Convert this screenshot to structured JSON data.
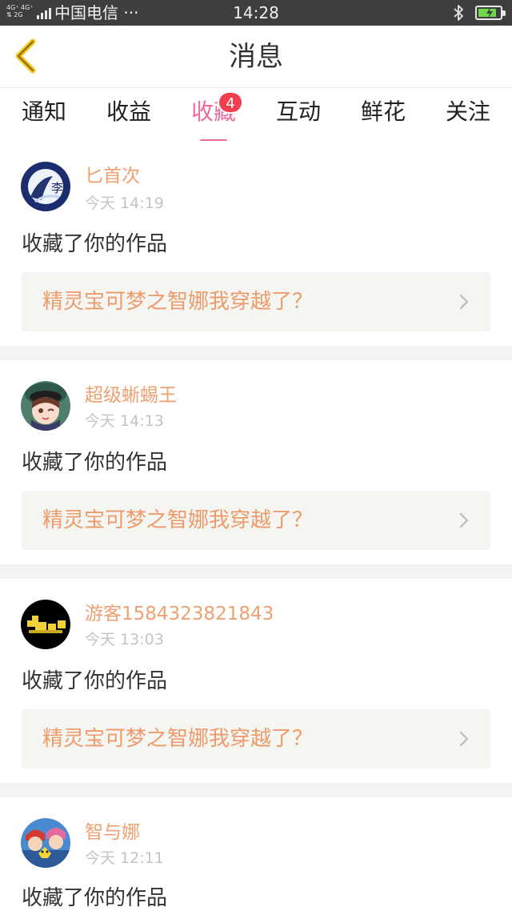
{
  "status_bar": {
    "signal_top": "4G⁺ 4G⁺",
    "signal_bottom": "⇅ 2G",
    "carrier": "中国电信 ···",
    "time": "14:28"
  },
  "header": {
    "title": "消息",
    "back_icon": "chevron-left-icon",
    "accent": "#f5c518"
  },
  "tabs": [
    {
      "label": "通知",
      "active": false
    },
    {
      "label": "收益",
      "active": false
    },
    {
      "label": "收藏",
      "active": true,
      "badge": "4"
    },
    {
      "label": "互动",
      "active": false
    },
    {
      "label": "鲜花",
      "active": false
    },
    {
      "label": "关注",
      "active": false
    }
  ],
  "colors": {
    "active_tab": "#f06a9c",
    "badge": "#f23f4f",
    "username": "#f0a070",
    "work_title": "#ee9b6b"
  },
  "messages": [
    {
      "username": "匕首次",
      "time": "今天 14:19",
      "action": "收藏了你的作品",
      "work_title": "精灵宝可梦之智娜我穿越了？",
      "avatar_text": "李"
    },
    {
      "username": "超级蜥蜴王",
      "time": "今天 14:13",
      "action": "收藏了你的作品",
      "work_title": "精灵宝可梦之智娜我穿越了？"
    },
    {
      "username": "游客1584323821843",
      "time": "今天 13:03",
      "action": "收藏了你的作品",
      "work_title": "精灵宝可梦之智娜我穿越了？"
    },
    {
      "username": "智与娜",
      "time": "今天 12:11",
      "action": "收藏了你的作品"
    }
  ]
}
